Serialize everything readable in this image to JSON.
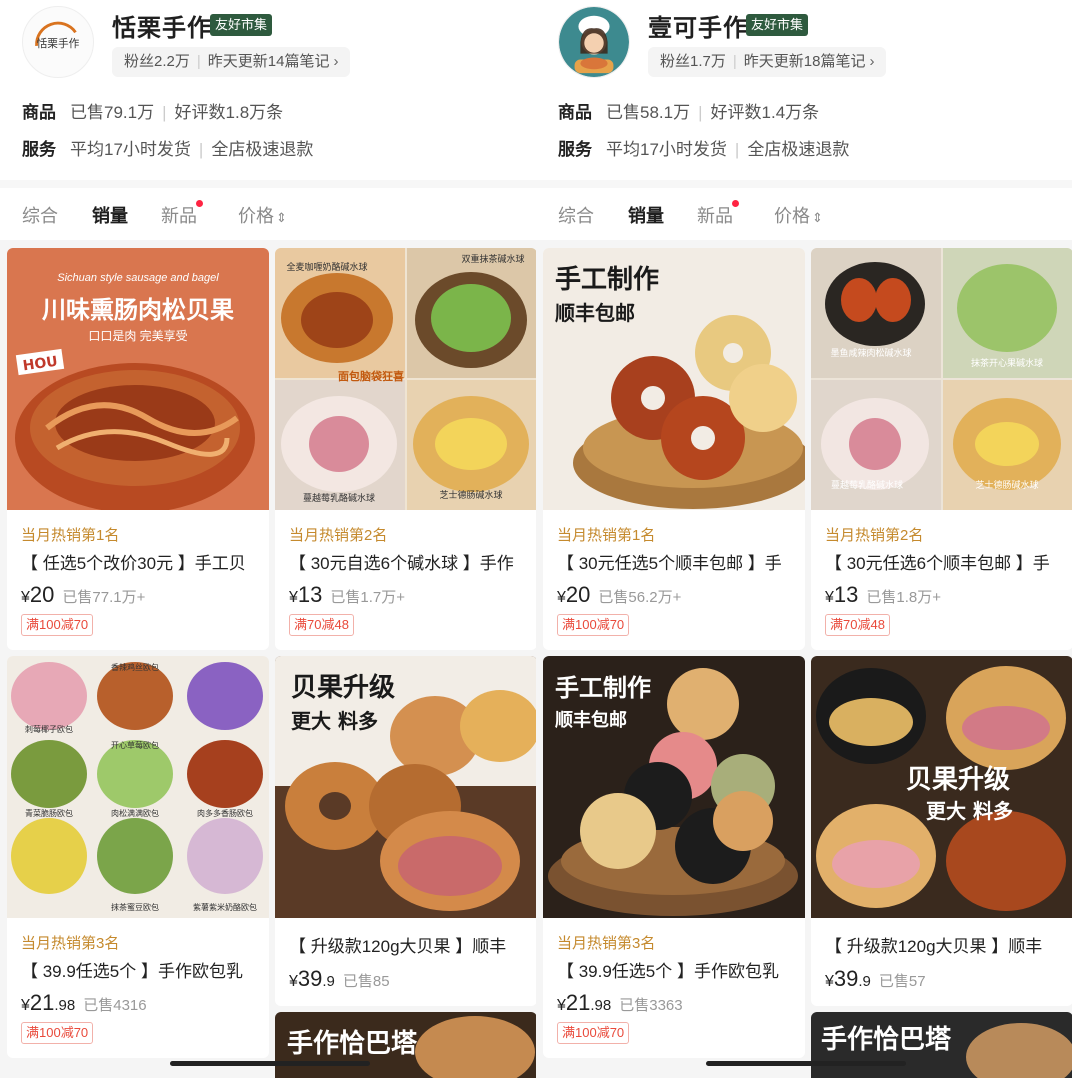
{
  "shops": [
    {
      "name": "恬栗手作",
      "avatar_text": "恬栗手作",
      "badge": "友好市集",
      "fans": "粉丝2.2万",
      "update": "昨天更新14篇笔记",
      "goods_label": "商品",
      "sold": "已售79.1万",
      "reviews": "好评数1.8万条",
      "service_label": "服务",
      "ship": "平均17小时发货",
      "refund": "全店极速退款",
      "sort": [
        "综合",
        "销量",
        "新品",
        "价格"
      ],
      "products": [
        {
          "image_text_en": "Sichuan style sausage and bagel",
          "image_title": "川味熏肠肉松贝果",
          "image_sub": "口口是肉 完美享受",
          "image_tag": "HOU",
          "rank": "当月热销第1名",
          "title": "【 任选5个改价30元 】手工贝",
          "cur": "¥",
          "price": "20",
          "dec": "",
          "sold": "已售77.1万+",
          "coupon": "满100减70"
        },
        {
          "image_labels": [
            "全麦咖喱奶酪碱水球",
            "双重抹茶碱水球",
            "面包脑袋狂喜",
            "蔓越莓乳酪碱水球",
            "芝士德肠碱水球"
          ],
          "rank": "当月热销第2名",
          "title": "【 30元自选6个碱水球 】手作",
          "cur": "¥",
          "price": "13",
          "dec": "",
          "sold": "已售1.7万+",
          "coupon": "满70减48"
        },
        {
          "image_labels": [
            "香辣鸡丝欧包",
            "刺莓椰子欧包",
            "开心草莓欧包",
            "肉多多香肠欧包",
            "青菜脆肠欧包",
            "肉松满满欧包",
            "紫薯紫米奶酪欧包",
            "抹茶蜜豆欧包"
          ],
          "rank": "当月热销第3名",
          "title": "【 39.9任选5个 】手作欧包乳",
          "cur": "¥",
          "price": "21",
          "dec": ".98",
          "sold": "已售4316",
          "coupon": "满100减70"
        },
        {
          "image_title": "贝果升级",
          "image_sub": "更大 料多",
          "title": "【 升级款120g大贝果 】顺丰",
          "cur": "¥",
          "price": "39",
          "dec": ".9",
          "sold": "已售85"
        }
      ],
      "next_banner": "手作恰巴塔"
    },
    {
      "name": "壹可手作",
      "badge": "友好市集",
      "fans": "粉丝1.7万",
      "update": "昨天更新18篇笔记",
      "goods_label": "商品",
      "sold": "已售58.1万",
      "reviews": "好评数1.4万条",
      "service_label": "服务",
      "ship": "平均17小时发货",
      "refund": "全店极速退款",
      "sort": [
        "综合",
        "销量",
        "新品",
        "价格"
      ],
      "products": [
        {
          "image_title": "手工制作",
          "image_sub": "顺丰包邮",
          "rank": "当月热销第1名",
          "title": "【 30元任选5个顺丰包邮 】手",
          "cur": "¥",
          "price": "20",
          "dec": "",
          "sold": "已售56.2万+",
          "coupon": "满100减70"
        },
        {
          "image_labels": [
            "墨鱼咸辣肉松碱水球",
            "抹茶开心果碱水球",
            "蔓越莓乳酪碱水球",
            "芝士德肠碱水球"
          ],
          "rank": "当月热销第2名",
          "title": "【 30元任选6个顺丰包邮 】手",
          "cur": "¥",
          "price": "13",
          "dec": "",
          "sold": "已售1.8万+",
          "coupon": "满70减48"
        },
        {
          "image_title": "手工制作",
          "image_sub": "顺丰包邮",
          "rank": "当月热销第3名",
          "title": "【 39.9任选5个 】手作欧包乳",
          "cur": "¥",
          "price": "21",
          "dec": ".98",
          "sold": "已售3363",
          "coupon": "满100减70"
        },
        {
          "image_title": "贝果升级",
          "image_sub": "更大 料多",
          "title": "【 升级款120g大贝果 】顺丰",
          "cur": "¥",
          "price": "39",
          "dec": ".9",
          "sold": "已售57"
        }
      ],
      "next_banner": "手作恰巴塔"
    }
  ],
  "icons": {
    "chevron": "›",
    "price_sort": "⇕"
  },
  "colors": {
    "badge_bg": "#2e5a3e",
    "rank_text": "#c58a2e",
    "coupon_text": "#e94a3b",
    "new_dot": "#ff2442"
  }
}
